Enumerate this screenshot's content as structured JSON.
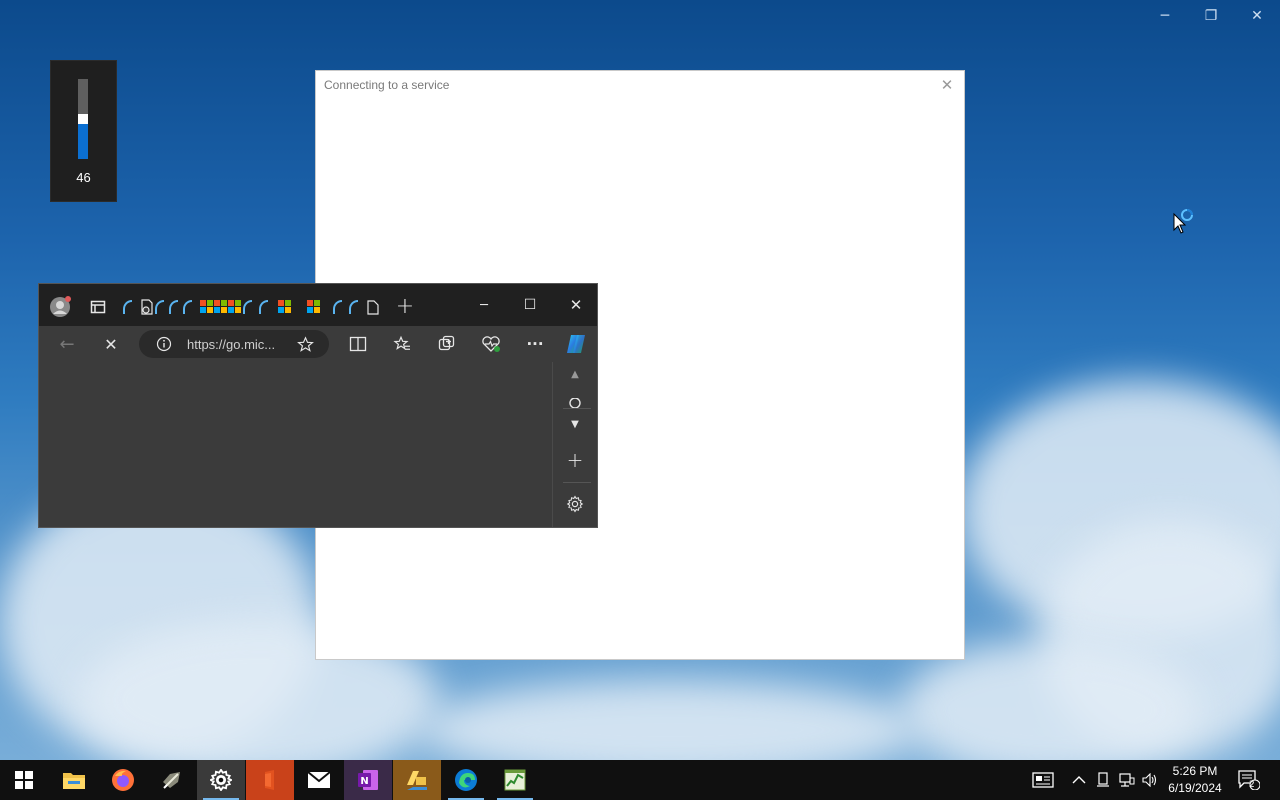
{
  "desktop": {
    "window_controls": {
      "minimize": "─",
      "restore": "❐",
      "close": "✕"
    }
  },
  "volume_flyout": {
    "level": 46,
    "label": "46",
    "fill_color": "#0b6fd1"
  },
  "dialog": {
    "title": "Connecting to a service",
    "close": "✕"
  },
  "edge": {
    "tabs": [
      "profile-icon",
      "tab-actions-icon",
      "loading-tab",
      "settings-tab",
      "loading-tab",
      "loading-tab",
      "microsoft-tab",
      "microsoft-tab",
      "microsoft-tab",
      "loading-tab",
      "microsoft-tab",
      "microsoft-tab",
      "loading-tab",
      "loading-tab",
      "page-tab"
    ],
    "new_tab": "+",
    "minimize": "─",
    "maximize": "☐",
    "close": "✕",
    "toolbar": {
      "back": "←",
      "stop": "✕",
      "address": "https://go.mic...",
      "more": "···"
    },
    "sidebar": {
      "add": "+"
    }
  },
  "taskbar": {
    "apps": [
      "start",
      "file-explorer",
      "firefox",
      "app-pen",
      "settings",
      "office",
      "mail",
      "onenote",
      "file-manager-blue",
      "edge",
      "task-manager"
    ],
    "time": "5:26 PM",
    "date": "6/19/2024",
    "notification_count": "2"
  }
}
